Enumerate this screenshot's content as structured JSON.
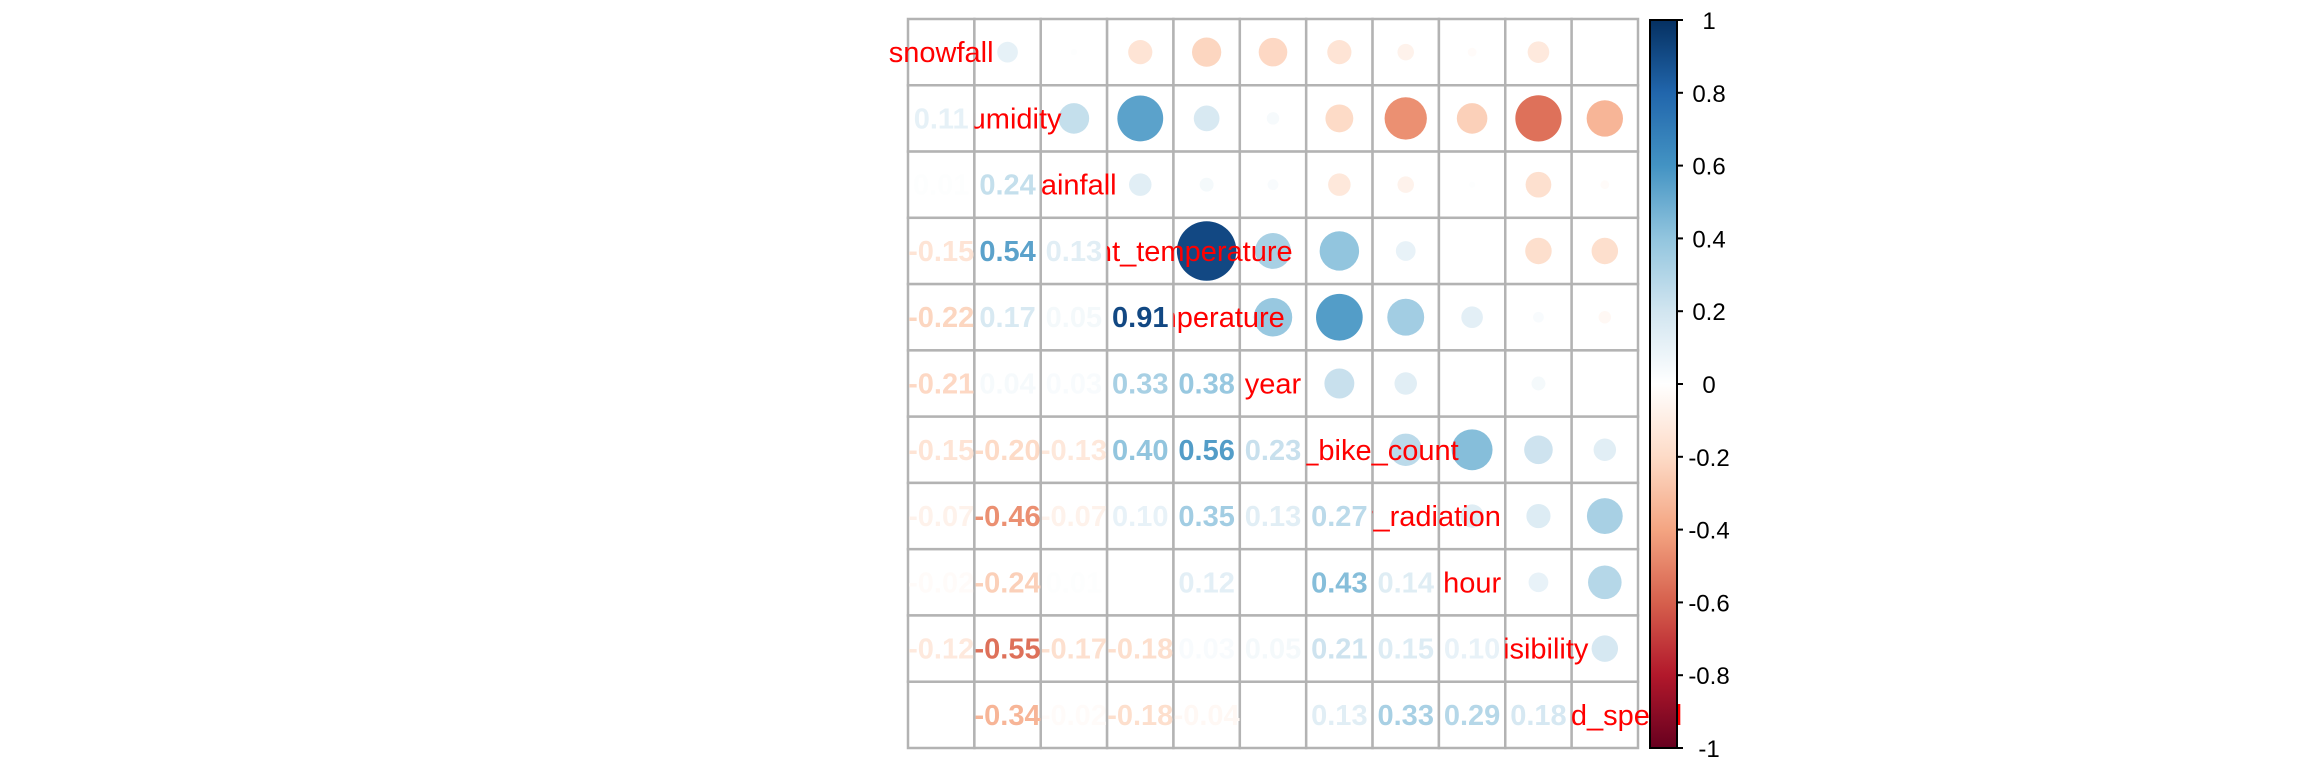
{
  "chart_data": {
    "type": "heatmap",
    "subtype": "correlation-matrix-mixed",
    "upper_method": "circle",
    "lower_method": "number",
    "label_position": "diagonal",
    "label_color": "#ff0000",
    "variables": [
      "snowfall",
      "humidity",
      "rainfall",
      "dew_point_temperature",
      "temperature",
      "year",
      "rented_bike_count",
      "solar_radiation",
      "hour",
      "visibility",
      "wind_speed"
    ],
    "matrix": [
      [
        1.0,
        0.11,
        0.01,
        -0.15,
        -0.22,
        -0.21,
        -0.15,
        -0.07,
        -0.02,
        -0.12,
        0.0
      ],
      [
        0.11,
        1.0,
        0.24,
        0.54,
        0.17,
        0.04,
        -0.2,
        -0.46,
        -0.24,
        -0.55,
        -0.34
      ],
      [
        0.01,
        0.24,
        1.0,
        0.13,
        0.05,
        0.03,
        -0.13,
        -0.07,
        0.01,
        -0.17,
        -0.02
      ],
      [
        -0.15,
        0.54,
        0.13,
        1.0,
        0.91,
        0.33,
        0.4,
        0.1,
        0.0,
        -0.18,
        -0.18
      ],
      [
        -0.22,
        0.17,
        0.05,
        0.91,
        1.0,
        0.38,
        0.56,
        0.35,
        0.12,
        0.03,
        -0.04
      ],
      [
        -0.21,
        0.04,
        0.03,
        0.33,
        0.38,
        1.0,
        0.23,
        0.13,
        0.0,
        0.05,
        0.0
      ],
      [
        -0.15,
        -0.2,
        -0.13,
        0.4,
        0.56,
        0.23,
        1.0,
        0.27,
        0.43,
        0.21,
        0.13
      ],
      [
        -0.07,
        -0.46,
        -0.07,
        0.1,
        0.35,
        0.13,
        0.27,
        1.0,
        0.14,
        0.15,
        0.33
      ],
      [
        -0.02,
        -0.24,
        0.01,
        0.0,
        0.12,
        0.0,
        0.43,
        0.14,
        1.0,
        0.1,
        0.29
      ],
      [
        -0.12,
        -0.55,
        -0.17,
        -0.18,
        0.03,
        0.05,
        0.21,
        0.15,
        0.1,
        1.0,
        0.18
      ],
      [
        0.0,
        -0.34,
        -0.02,
        -0.18,
        -0.04,
        0.0,
        0.13,
        0.33,
        0.29,
        0.18,
        1.0
      ]
    ],
    "colorbar": {
      "range": [
        -1,
        1
      ],
      "ticks": [
        "1",
        "0.8",
        "0.6",
        "0.4",
        "0.2",
        "0",
        "-0.2",
        "-0.4",
        "-0.6",
        "-0.8",
        "-1"
      ],
      "tick_values": [
        1,
        0.8,
        0.6,
        0.4,
        0.2,
        0,
        -0.2,
        -0.4,
        -0.6,
        -0.8,
        -1
      ],
      "palette": [
        "#67001F",
        "#B2182B",
        "#D6604D",
        "#F4A582",
        "#FDDBC7",
        "#FFFFFF",
        "#D1E5F0",
        "#92C5DE",
        "#4393C3",
        "#2166AC",
        "#053061"
      ]
    },
    "grid": true,
    "grid_color": "#b3b3b3"
  }
}
